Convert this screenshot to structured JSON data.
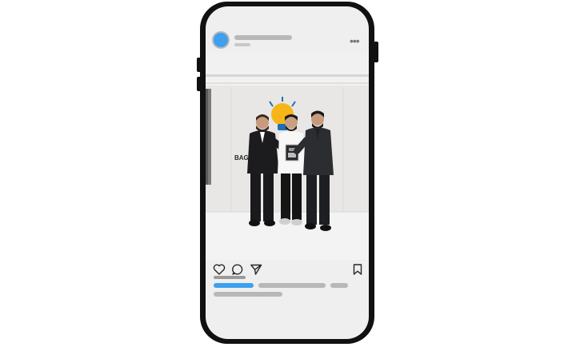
{
  "post": {
    "wall_sign_text": "BAG",
    "colors": {
      "avatar": "#3ea0ee",
      "caption_highlight": "#3ea0ee",
      "phone_frame": "#111111",
      "skeleton": "#b8b8b8"
    },
    "header": {
      "more_label": "•••"
    },
    "actions": {
      "icons": [
        "heart-icon",
        "comment-icon",
        "share-icon",
        "bookmark-icon"
      ]
    }
  }
}
